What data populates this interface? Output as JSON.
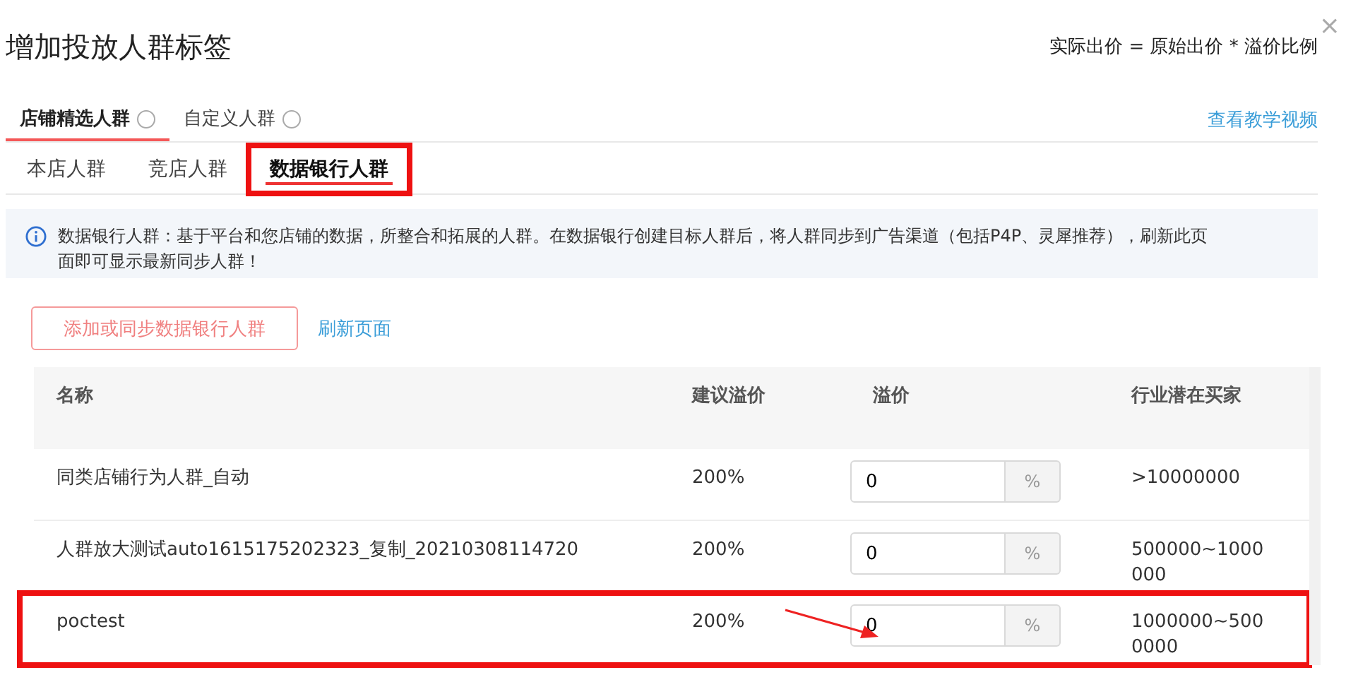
{
  "dialog": {
    "title": "增加投放人群标签",
    "formula": "实际出价 = 原始出价 * 溢价比例",
    "close": "×"
  },
  "tabs": [
    {
      "label": "店铺精选人群",
      "selected": true,
      "help": true
    },
    {
      "label": "自定义人群",
      "selected": false,
      "help": true
    }
  ],
  "tutorial_link": "查看教学视频",
  "subtabs": [
    {
      "label": "本店人群",
      "selected": false,
      "highlighted": false
    },
    {
      "label": "竞店人群",
      "selected": false,
      "highlighted": false
    },
    {
      "label": "数据银行人群",
      "selected": true,
      "highlighted": true
    }
  ],
  "info": "数据银行人群：基于平台和您店铺的数据，所整合和拓展的人群。在数据银行创建目标人群后，将人群同步到广告渠道（包括P4P、灵犀推荐），刷新此页面即可显示最新同步人群！",
  "actions": {
    "add_button": "添加或同步数据银行人群",
    "refresh_link": "刷新页面"
  },
  "table": {
    "columns": [
      "名称",
      "建议溢价",
      "溢价",
      "行业潜在买家"
    ],
    "rows": [
      {
        "name": "同类店铺行为人群_自动",
        "suggested": "200%",
        "premium": "0",
        "unit": "%",
        "buyers": ">10000000",
        "highlighted": false
      },
      {
        "name": "人群放大测试auto1615175202323_复制_20210308114720",
        "suggested": "200%",
        "premium": "0",
        "unit": "%",
        "buyers": "500000~1000000",
        "highlighted": false
      },
      {
        "name": "poctest",
        "suggested": "200%",
        "premium": "0",
        "unit": "%",
        "buyers": "1000000~5000000",
        "highlighted": true
      }
    ]
  }
}
